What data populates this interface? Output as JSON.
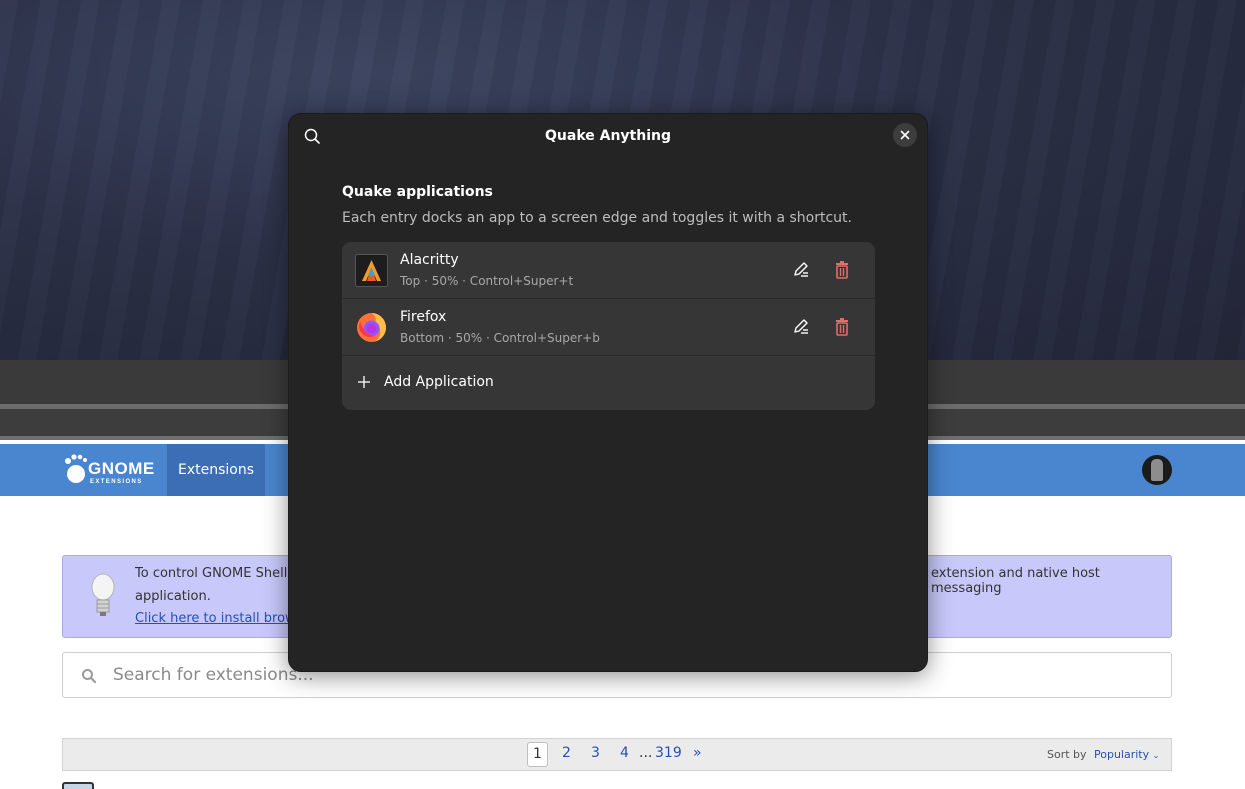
{
  "dialog": {
    "title": "Quake Anything",
    "group_title": "Quake applications",
    "group_description": "Each entry docks an app to a screen edge and toggles it with a shortcut.",
    "apps": [
      {
        "name": "Alacritty",
        "meta": "Top · 50% · Control+Super+t",
        "icon": "alacritty-icon"
      },
      {
        "name": "Firefox",
        "meta": "Bottom · 50% · Control+Super+b",
        "icon": "firefox-icon"
      }
    ],
    "add_label": "Add Application",
    "accent_delete": "#e66c6c"
  },
  "site": {
    "logo_word": "GNOME",
    "logo_sub": "EXTENSIONS",
    "nav_extensions": "Extensions",
    "alert_line1": "To control GNOME Shell",
    "alert_line1_end": "extension and native host messaging",
    "alert_line2": "application.",
    "alert_link": "Click here to install brow",
    "search_placeholder": "Search for extensions...",
    "pages": [
      "1",
      "2",
      "3",
      "4",
      "...",
      "319",
      "»"
    ],
    "sort_label": "Sort by",
    "sort_value": "Popularity"
  },
  "colors": {
    "header_blue": "#4a86cf",
    "nav_active": "#3b6eb4",
    "alert_bg": "#c8c8fb",
    "dialog_bg": "#242424"
  }
}
